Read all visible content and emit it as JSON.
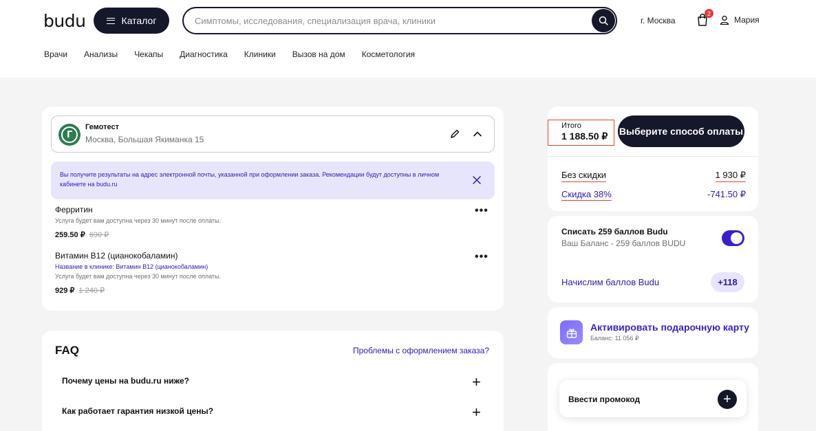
{
  "header": {
    "logo": "budu",
    "catalog_label": "Каталог",
    "search_placeholder": "Симптомы, исследования, специализация врача, клиники",
    "city": "г. Москва",
    "cart_count": "2",
    "user_name": "Мария"
  },
  "nav": [
    "Врачи",
    "Анализы",
    "Чекапы",
    "Диагностика",
    "Клиники",
    "Вызов на дом",
    "Косметология"
  ],
  "clinic": {
    "name": "Гемотест",
    "address": "Москва, Большая Якиманка 15",
    "notice": "Вы получите результаты на адрес электронной почты, указанной при оформлении заказа. Рекомендации будут доступны в личном кабинете на budu.ru"
  },
  "services": [
    {
      "title": "Ферритин",
      "availability": "Услуга будет вам доступна через 30 минут после оплаты.",
      "price": "259.50 ₽",
      "old_price": "690 ₽"
    },
    {
      "title": "Витамин B12 (цианокобаламин)",
      "clinic_name": "Название в клинике: Витамин B12 (цианокобаламин)",
      "availability": "Услуга будет вам доступна через 30 минут после оплаты.",
      "price": "929 ₽",
      "old_price": "1 240 ₽"
    }
  ],
  "faq": {
    "title": "FAQ",
    "problem_link": "Проблемы с оформлением заказа?",
    "items": [
      "Почему цены на budu.ru ниже?",
      "Как работает гарантия низкой цены?"
    ]
  },
  "summary": {
    "total_label": "Итого",
    "total_value": "1 188.50 ₽",
    "pay_button": "Выберите способ оплаты",
    "no_discount_label": "Без скидки",
    "no_discount_value": "1 930 ₽",
    "discount_label": "Скидка 38%",
    "discount_value": "-741.50 ₽"
  },
  "bonus": {
    "title": "Списать 259 баллов Budu",
    "balance": "Ваш Баланс - 259 баллов BUDU",
    "toggle_on": true,
    "accrue_label": "Начислим баллов Budu",
    "accrue_value": "+118"
  },
  "gift": {
    "title": "Активировать подарочную карту",
    "balance": "Баланс: 11 056 ₽"
  },
  "promo": {
    "label": "Ввести промокод"
  },
  "colors": {
    "dark": "#15172b",
    "accent": "#3a1fd0",
    "notice_bg": "#e7e5fb",
    "highlight_border": "#e0432b"
  }
}
